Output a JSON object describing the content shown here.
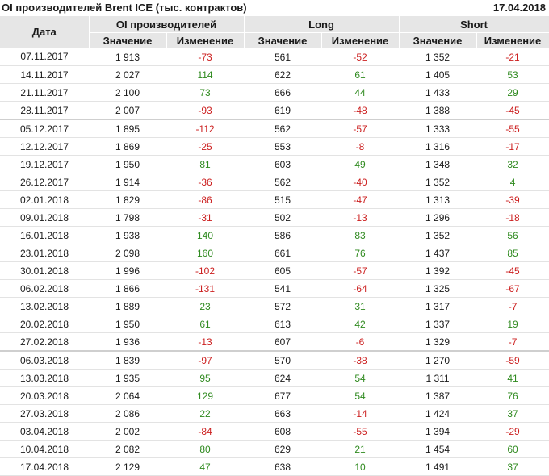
{
  "header": {
    "title": "OI производителей Brent ICE (тыс. контрактов)",
    "date": "17.04.2018"
  },
  "table": {
    "date_header": "Дата",
    "groups": [
      "OI производителей",
      "Long",
      "Short"
    ],
    "sub_headers": [
      "Значение",
      "Изменение",
      "Значение",
      "Изменение",
      "Значение",
      "Изменение"
    ],
    "rows": [
      {
        "date": "07.11.2017",
        "oi": "1 913",
        "oi_chg": "-73",
        "long": "561",
        "long_chg": "-52",
        "short": "1 352",
        "short_chg": "-21"
      },
      {
        "date": "14.11.2017",
        "oi": "2 027",
        "oi_chg": "114",
        "long": "622",
        "long_chg": "61",
        "short": "1 405",
        "short_chg": "53"
      },
      {
        "date": "21.11.2017",
        "oi": "2 100",
        "oi_chg": "73",
        "long": "666",
        "long_chg": "44",
        "short": "1 433",
        "short_chg": "29"
      },
      {
        "date": "28.11.2017",
        "oi": "2 007",
        "oi_chg": "-93",
        "long": "619",
        "long_chg": "-48",
        "short": "1 388",
        "short_chg": "-45"
      },
      {
        "date": "05.12.2017",
        "oi": "1 895",
        "oi_chg": "-112",
        "long": "562",
        "long_chg": "-57",
        "short": "1 333",
        "short_chg": "-55"
      },
      {
        "date": "12.12.2017",
        "oi": "1 869",
        "oi_chg": "-25",
        "long": "553",
        "long_chg": "-8",
        "short": "1 316",
        "short_chg": "-17"
      },
      {
        "date": "19.12.2017",
        "oi": "1 950",
        "oi_chg": "81",
        "long": "603",
        "long_chg": "49",
        "short": "1 348",
        "short_chg": "32"
      },
      {
        "date": "26.12.2017",
        "oi": "1 914",
        "oi_chg": "-36",
        "long": "562",
        "long_chg": "-40",
        "short": "1 352",
        "short_chg": "4"
      },
      {
        "date": "02.01.2018",
        "oi": "1 829",
        "oi_chg": "-86",
        "long": "515",
        "long_chg": "-47",
        "short": "1 313",
        "short_chg": "-39"
      },
      {
        "date": "09.01.2018",
        "oi": "1 798",
        "oi_chg": "-31",
        "long": "502",
        "long_chg": "-13",
        "short": "1 296",
        "short_chg": "-18"
      },
      {
        "date": "16.01.2018",
        "oi": "1 938",
        "oi_chg": "140",
        "long": "586",
        "long_chg": "83",
        "short": "1 352",
        "short_chg": "56"
      },
      {
        "date": "23.01.2018",
        "oi": "2 098",
        "oi_chg": "160",
        "long": "661",
        "long_chg": "76",
        "short": "1 437",
        "short_chg": "85"
      },
      {
        "date": "30.01.2018",
        "oi": "1 996",
        "oi_chg": "-102",
        "long": "605",
        "long_chg": "-57",
        "short": "1 392",
        "short_chg": "-45"
      },
      {
        "date": "06.02.2018",
        "oi": "1 866",
        "oi_chg": "-131",
        "long": "541",
        "long_chg": "-64",
        "short": "1 325",
        "short_chg": "-67"
      },
      {
        "date": "13.02.2018",
        "oi": "1 889",
        "oi_chg": "23",
        "long": "572",
        "long_chg": "31",
        "short": "1 317",
        "short_chg": "-7"
      },
      {
        "date": "20.02.2018",
        "oi": "1 950",
        "oi_chg": "61",
        "long": "613",
        "long_chg": "42",
        "short": "1 337",
        "short_chg": "19"
      },
      {
        "date": "27.02.2018",
        "oi": "1 936",
        "oi_chg": "-13",
        "long": "607",
        "long_chg": "-6",
        "short": "1 329",
        "short_chg": "-7"
      },
      {
        "date": "06.03.2018",
        "oi": "1 839",
        "oi_chg": "-97",
        "long": "570",
        "long_chg": "-38",
        "short": "1 270",
        "short_chg": "-59"
      },
      {
        "date": "13.03.2018",
        "oi": "1 935",
        "oi_chg": "95",
        "long": "624",
        "long_chg": "54",
        "short": "1 311",
        "short_chg": "41"
      },
      {
        "date": "20.03.2018",
        "oi": "2 064",
        "oi_chg": "129",
        "long": "677",
        "long_chg": "54",
        "short": "1 387",
        "short_chg": "76"
      },
      {
        "date": "27.03.2018",
        "oi": "2 086",
        "oi_chg": "22",
        "long": "663",
        "long_chg": "-14",
        "short": "1 424",
        "short_chg": "37"
      },
      {
        "date": "03.04.2018",
        "oi": "2 002",
        "oi_chg": "-84",
        "long": "608",
        "long_chg": "-55",
        "short": "1 394",
        "short_chg": "-29"
      },
      {
        "date": "10.04.2018",
        "oi": "2 082",
        "oi_chg": "80",
        "long": "629",
        "long_chg": "21",
        "short": "1 454",
        "short_chg": "60"
      },
      {
        "date": "17.04.2018",
        "oi": "2 129",
        "oi_chg": "47",
        "long": "638",
        "long_chg": "10",
        "short": "1 491",
        "short_chg": "37"
      }
    ]
  },
  "colors": {
    "positive": "#2f8a1f",
    "negative": "#cc2020",
    "header_bg": "#e6e6e6"
  }
}
